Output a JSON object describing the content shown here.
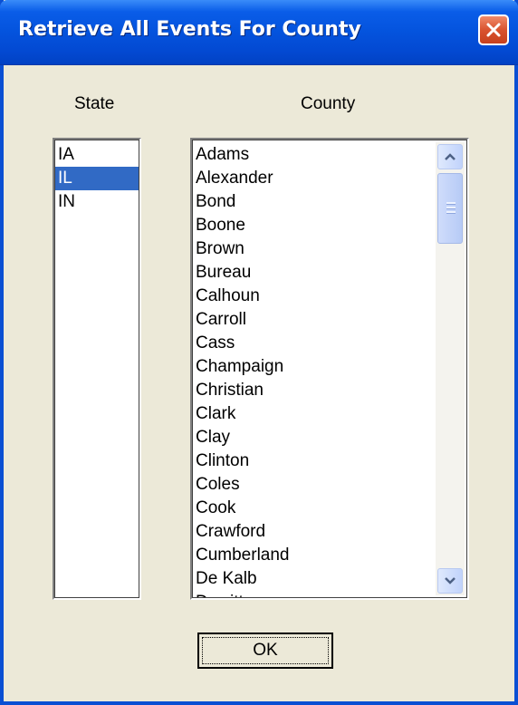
{
  "window": {
    "title": "Retrieve All Events For County"
  },
  "labels": {
    "state": "State",
    "county": "County"
  },
  "state_list": {
    "items": [
      "IA",
      "IL",
      "IN"
    ],
    "selected": "IL"
  },
  "county_list": {
    "items": [
      "Adams",
      "Alexander",
      "Bond",
      "Boone",
      "Brown",
      "Bureau",
      "Calhoun",
      "Carroll",
      "Cass",
      "Champaign",
      "Christian",
      "Clark",
      "Clay",
      "Clinton",
      "Coles",
      "Cook",
      "Crawford",
      "Cumberland",
      "De Kalb",
      "Dewitt"
    ],
    "scroll_position": 0.0
  },
  "buttons": {
    "ok": "OK"
  },
  "colors": {
    "selection": "#316ac5",
    "titlebar": "#0453dd",
    "window_bg": "#ece9d8"
  }
}
